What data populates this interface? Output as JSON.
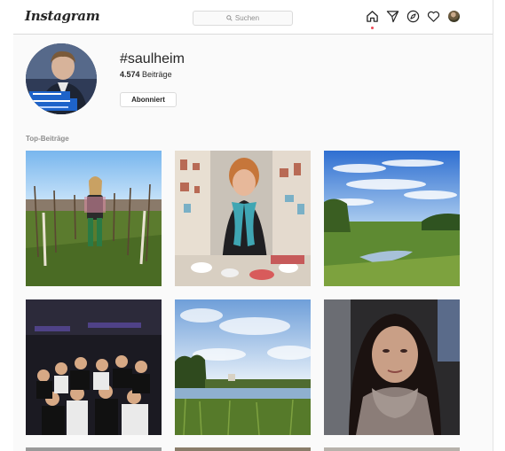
{
  "header": {
    "logo": "Instagram",
    "search_placeholder": "Suchen"
  },
  "profile": {
    "hashtag": "#saulheim",
    "post_count": "4.574",
    "post_count_label": "Beiträge",
    "follow_button_label": "Abonniert"
  },
  "section": {
    "title": "Top-Beiträge"
  },
  "posts": [
    {
      "subject": "vineyard-woman"
    },
    {
      "subject": "ceramics-shop-woman"
    },
    {
      "subject": "river-meadow-sky"
    },
    {
      "subject": "group-photo-party"
    },
    {
      "subject": "lake-landscape"
    },
    {
      "subject": "selfie-woman-scarf"
    }
  ],
  "colors": {
    "background": "#fafafa",
    "border": "#dbdbdb",
    "text": "#262626",
    "muted": "#8e8e8e",
    "notification": "#ed4956"
  },
  "icons": [
    "home-icon",
    "direct-icon",
    "explore-icon",
    "heart-icon",
    "search-icon"
  ]
}
